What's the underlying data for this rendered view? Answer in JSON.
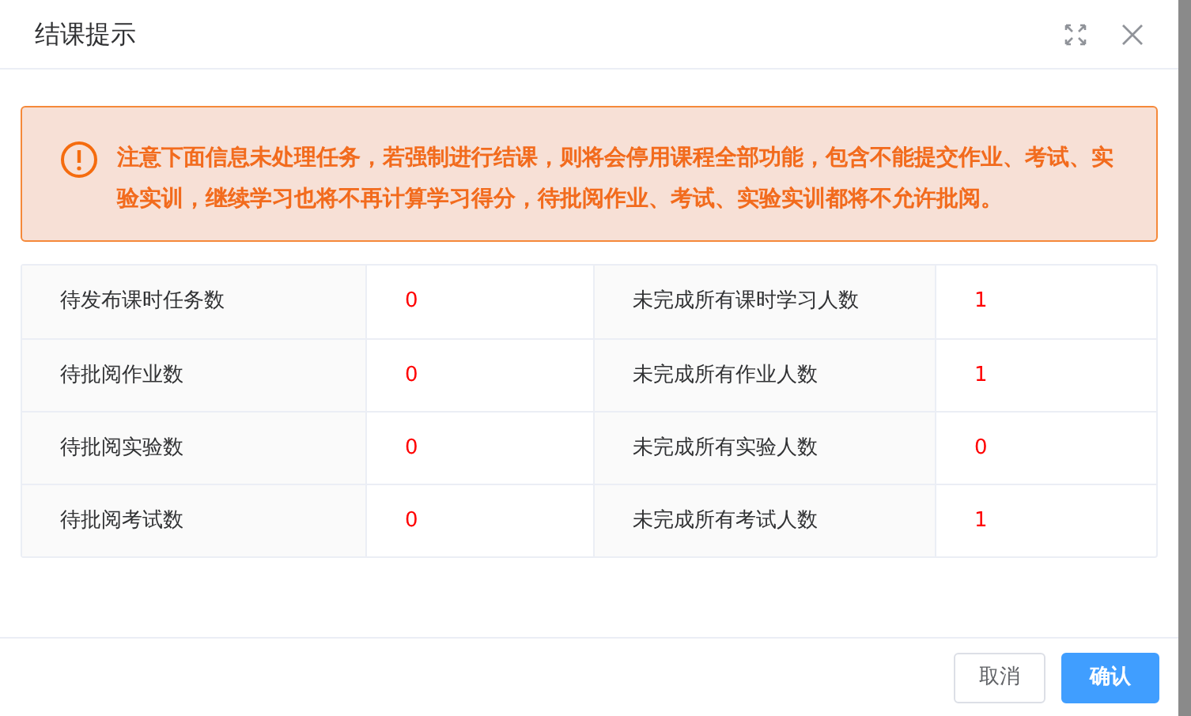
{
  "dialog": {
    "title": "结课提示"
  },
  "alert": {
    "text": "注意下面信息未处理任务，若强制进行结课，则将会停用课程全部功能，包含不能提交作业、考试、实验实训，继续学习也将不再计算学习得分，待批阅作业、考试、实验实训都将不允许批阅。"
  },
  "table": {
    "rows": [
      {
        "label_1": "待发布课时任务数",
        "value_1": "0",
        "label_2": "未完成所有课时学习人数",
        "value_2": "1"
      },
      {
        "label_1": "待批阅作业数",
        "value_1": "0",
        "label_2": "未完成所有作业人数",
        "value_2": "1"
      },
      {
        "label_1": "待批阅实验数",
        "value_1": "0",
        "label_2": "未完成所有实验人数",
        "value_2": "0"
      },
      {
        "label_1": "待批阅考试数",
        "value_1": "0",
        "label_2": "未完成所有考试人数",
        "value_2": "1"
      }
    ]
  },
  "buttons": [
    {
      "label": "取消",
      "kind": "secondary"
    },
    {
      "label": "确认",
      "kind": "primary"
    }
  ]
}
